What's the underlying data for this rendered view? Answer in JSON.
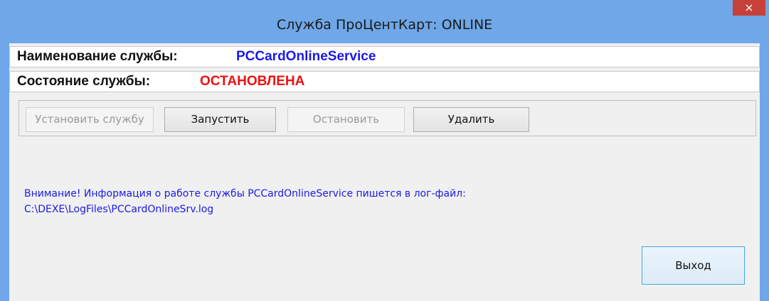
{
  "window": {
    "title": "Служба ПроЦентКарт: ONLINE",
    "close_glyph": "×"
  },
  "service": {
    "name_label": "Наименование службы:",
    "name_value": "PCCardOnlineService",
    "status_label": "Состояние службы:",
    "status_value": "ОСТАНОВЛЕНА"
  },
  "buttons": {
    "install": "Установить службу",
    "start": "Запустить",
    "stop": "Остановить",
    "delete": "Удалить",
    "exit": "Выход"
  },
  "info": {
    "line1": "Внимание! Информация о работе службы PCCardOnlineService пишется в лог-файл:",
    "line2": "C:\\DEXE\\LogFiles\\PCCardOnlineSrv.log"
  },
  "colors": {
    "frame": "#6fa7e8",
    "service_name": "#1a1ae6",
    "status_stopped": "#ee1111",
    "info_text": "#1a1ae6",
    "close_button": "#c7413a"
  }
}
